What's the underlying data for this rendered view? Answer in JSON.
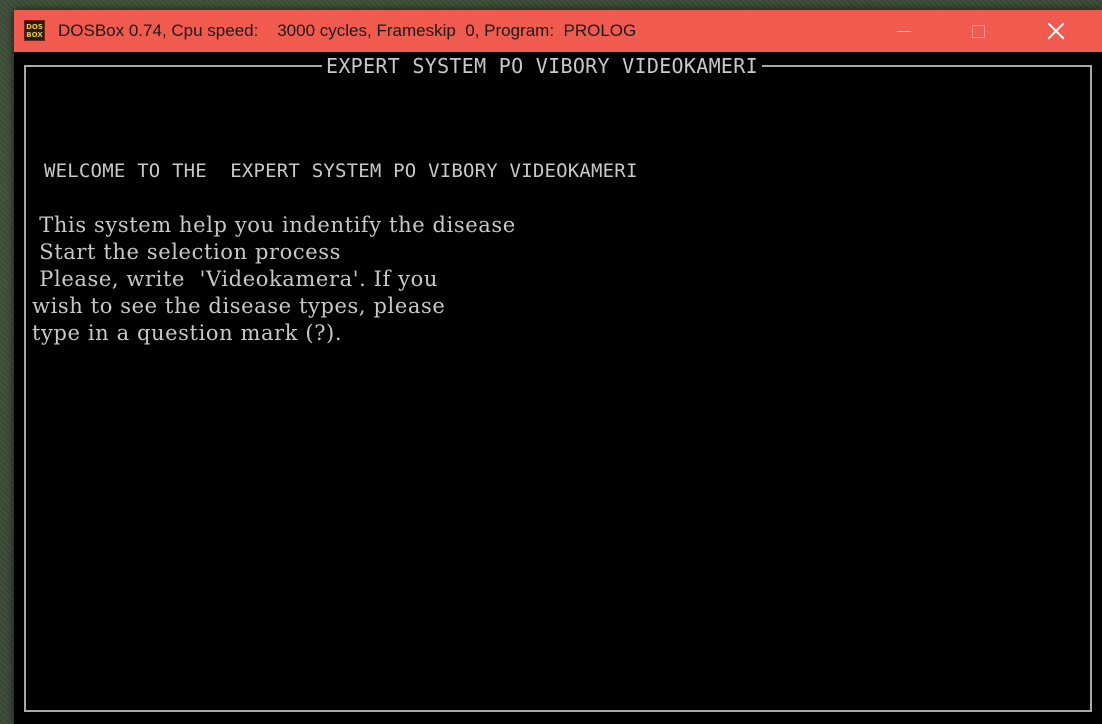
{
  "window": {
    "icon_top": "DOS",
    "icon_bottom": "BOX",
    "title": "DOSBox 0.74, Cpu speed:    3000 cycles, Frameskip  0, Program:  PROLOG",
    "colors": {
      "titlebar": "#f15a4e",
      "screen_bg": "#000000",
      "screen_text": "#c8c8c8"
    }
  },
  "controls": {
    "minimize": "minimize-icon",
    "maximize": "maximize-icon",
    "close": "close-icon"
  },
  "screen": {
    "frame_title": "EXPERT SYSTEM PO VIBORY VIDEOKAMERI",
    "welcome": "WELCOME TO THE  EXPERT SYSTEM PO VIBORY VIDEOKAMERI",
    "lines": [
      " This system help you indentify the disease",
      " Start the selection process",
      " Please, write  'Videokamera'. If you",
      "wish to see the disease types, please",
      "type in a question mark (?)."
    ]
  }
}
